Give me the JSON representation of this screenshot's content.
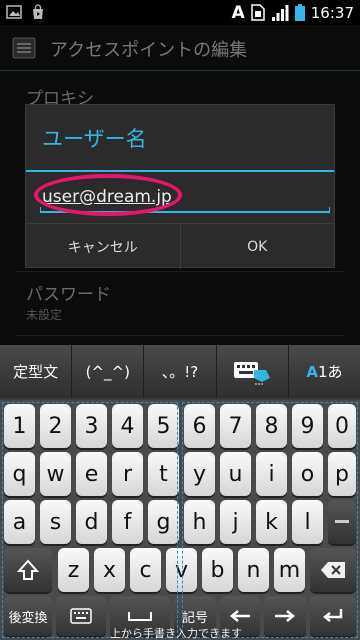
{
  "status_bar": {
    "time": "16:37",
    "icons": [
      "image-icon",
      "store-icon",
      "a-icon",
      "sim-icon",
      "signal-icon",
      "battery-icon"
    ]
  },
  "settings": {
    "title": "アクセスポイントの編集",
    "proxy_label": "プロキシ",
    "password_label": "パスワード",
    "password_value": "未設定"
  },
  "dialog": {
    "title": "ユーザー名",
    "input_value": "user@dream.jp",
    "cancel_label": "キャンセル",
    "ok_label": "OK"
  },
  "keyboard": {
    "top_bar": {
      "template": "定型文",
      "emoticon": "(^_^)",
      "punct": "、。!?",
      "mode_a": "A",
      "mode_rest": "1あ"
    },
    "row_numbers": [
      "1",
      "2",
      "3",
      "4",
      "5",
      "6",
      "7",
      "8",
      "9",
      "0"
    ],
    "row_q": [
      "q",
      "w",
      "e",
      "r",
      "t",
      "y",
      "u",
      "i",
      "o",
      "p"
    ],
    "row_a": [
      "a",
      "s",
      "d",
      "f",
      "g",
      "h",
      "j",
      "k",
      "l"
    ],
    "row_z": [
      "z",
      "x",
      "c",
      "v",
      "b",
      "n",
      "m"
    ],
    "convert_label": "後変換",
    "symbol_label": "記号",
    "handwrite_hint": "上から手書き入力できます",
    "colors": {
      "accent": "#33b5e5",
      "highlight": "#e8166b"
    }
  }
}
